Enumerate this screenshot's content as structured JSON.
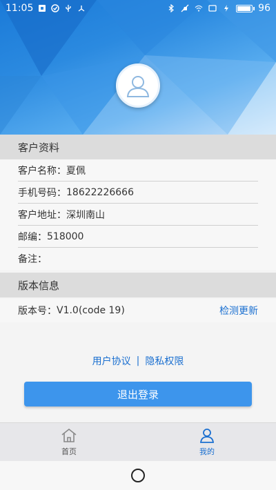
{
  "status_bar": {
    "time": "11:05",
    "battery": "96",
    "battery_level": 0.96
  },
  "profile": {
    "section_title": "客户资料",
    "rows": [
      {
        "label": "客户名称：",
        "value": "夏佩"
      },
      {
        "label": "手机号码：",
        "value": "18622226666"
      },
      {
        "label": "客户地址：",
        "value": "深圳南山"
      },
      {
        "label": "邮编：",
        "value": "518000"
      },
      {
        "label": "备注：",
        "value": ""
      }
    ]
  },
  "version": {
    "section_title": "版本信息",
    "label": "版本号：",
    "value": "V1.0(code 19)",
    "check_update": "检测更新"
  },
  "links": {
    "user_agreement": "用户协议",
    "separator": "|",
    "privacy": "隐私权限"
  },
  "logout_label": "退出登录",
  "tabs": [
    {
      "label": "首页",
      "icon": "home-icon",
      "active": false
    },
    {
      "label": "我的",
      "icon": "user-icon",
      "active": true
    }
  ],
  "colors": {
    "accent": "#1a6fd0",
    "button": "#3d95ec",
    "header": "#2b8ae0"
  }
}
